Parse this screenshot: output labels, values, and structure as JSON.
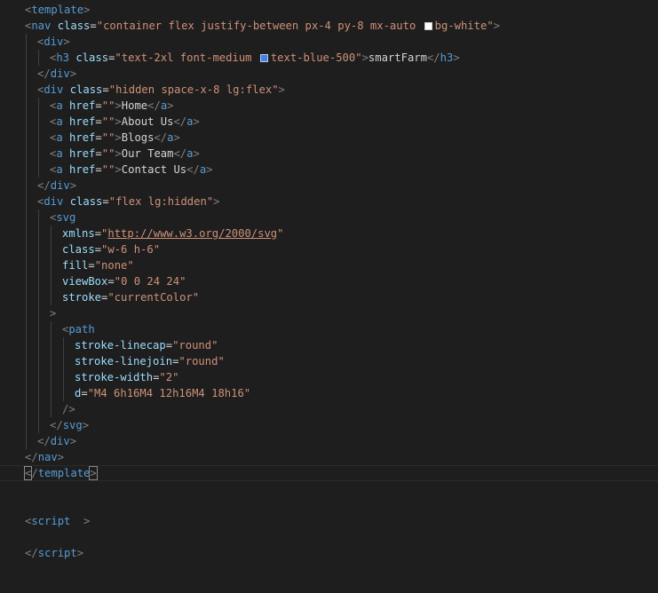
{
  "editor": {
    "language": "vue",
    "colors": {
      "background": "#1e1e1e",
      "tag": "#569cd6",
      "attribute": "#9cdcfe",
      "string": "#ce9178",
      "text": "#d4d4d4",
      "bracket": "#808080"
    },
    "swatches": {
      "bg_white": "#ffffff",
      "text_blue_500": "#3b82f6"
    },
    "lines": {
      "l1_tag": "template",
      "l2_tag": "nav",
      "l2_attr": "class",
      "l2_val_a": "container flex justify-between px-4 py-8 mx-auto ",
      "l2_val_b": "bg-white",
      "l3_tag": "div",
      "l4_tag": "h3",
      "l4_attr": "class",
      "l4_val_a": "text-2xl font-medium ",
      "l4_val_b": "text-blue-500",
      "l4_text": "smartFarm",
      "l5_tag": "div",
      "l6_tag": "div",
      "l6_attr": "class",
      "l6_val": "hidden space-x-8 lg:flex",
      "a_tag": "a",
      "href_attr": "href",
      "empty_str": "\"\"",
      "link_1": "Home",
      "link_2": "About Us",
      "link_3": "Blogs",
      "link_4": "Our Team",
      "link_5": "Contact Us",
      "l12_tag": "div",
      "l13_tag": "div",
      "l13_attr": "class",
      "l13_val": "flex lg:hidden",
      "svg_tag": "svg",
      "xmlns_attr": "xmlns",
      "xmlns_val": "http://www.w3.org/2000/svg",
      "svg_class_attr": "class",
      "svg_class_val": "w-6 h-6",
      "fill_attr": "fill",
      "fill_val": "none",
      "viewbox_attr": "viewBox",
      "viewbox_val": "0 0 24 24",
      "stroke_attr": "stroke",
      "stroke_val": "currentColor",
      "close_gt": ">",
      "path_tag": "path",
      "linecap_attr": "stroke-linecap",
      "linecap_val": "round",
      "linejoin_attr": "stroke-linejoin",
      "linejoin_val": "round",
      "width_attr": "stroke-width",
      "width_val": "2",
      "d_attr": "d",
      "d_val": "M4 6h16M4 12h16M4 18h16",
      "self_close": "/>",
      "svg_end_tag": "svg",
      "div_end_tag": "div",
      "nav_end_tag": "nav",
      "template_end_tag": "template",
      "script_open": "script",
      "script_close": "script"
    }
  }
}
